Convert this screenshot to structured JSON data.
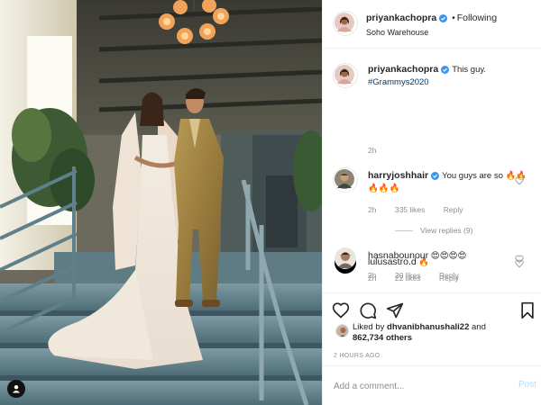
{
  "post": {
    "author": "priyankachopra",
    "follow_status": "Following",
    "location": "Soho Warehouse",
    "accent_color": "#3897f0"
  },
  "caption": {
    "username": "priyankachopra",
    "text": "This guy.",
    "hashtag": "#Grammys2020",
    "time": "2h"
  },
  "comments": [
    {
      "username": "harryjoshhair",
      "text": "You guys are so 🔥🔥🔥🔥🔥",
      "time": "2h",
      "likes": "335 likes",
      "reply": "Reply",
      "view_replies": "View replies (9)"
    },
    {
      "username": "lulusastro.d",
      "text": "🔥",
      "time": "2h",
      "likes": "22 likes",
      "reply": "Reply"
    },
    {
      "username": "hasnabounour",
      "text": "😍😍😍😍",
      "time": "2h",
      "likes": "20 likes",
      "reply": "Reply"
    }
  ],
  "likes": {
    "prefix": "Liked by",
    "user": "dhvanibhanushali22",
    "and": "and",
    "count": "862,734 others"
  },
  "time_ago": "2 HOURS AGO",
  "comment_box": {
    "placeholder": "Add a comment...",
    "post_label": "Post"
  },
  "icons": {
    "like": "heart-icon",
    "comment": "comment-bubble-icon",
    "share": "paper-plane-icon",
    "save": "bookmark-icon",
    "verified": "verified-badge-icon",
    "user_tag": "person-tag-icon"
  }
}
